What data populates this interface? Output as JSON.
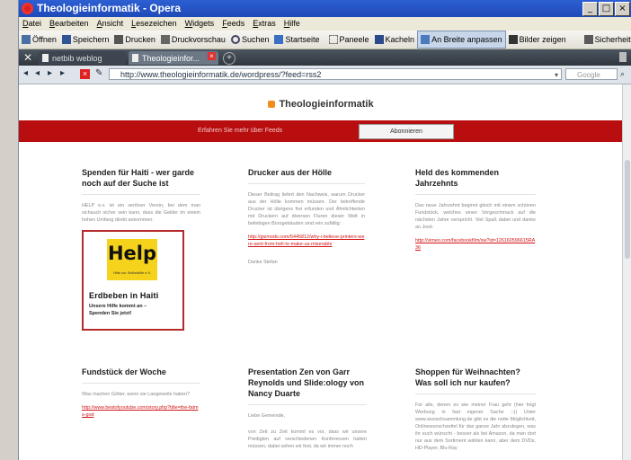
{
  "window": {
    "title": "Theologieinformatik - Opera"
  },
  "menu": [
    "Datei",
    "Bearbeiten",
    "Ansicht",
    "Lesezeichen",
    "Widgets",
    "Feeds",
    "Extras",
    "Hilfe"
  ],
  "toolbar": [
    {
      "label": "Öffnen",
      "icon": "folder-icon"
    },
    {
      "label": "Speichern",
      "icon": "save-icon"
    },
    {
      "label": "Drucken",
      "icon": "print-icon"
    },
    {
      "label": "Druckvorschau",
      "icon": "print-preview-icon"
    },
    {
      "label": "Suchen",
      "icon": "search-icon"
    },
    {
      "label": "Startseite",
      "icon": "home-icon"
    },
    {
      "label": "Paneele",
      "icon": "panels-icon"
    },
    {
      "label": "Kacheln",
      "icon": "tile-icon"
    },
    {
      "label": "An Breite anpassen",
      "icon": "fit-width-icon",
      "active": true
    },
    {
      "label": "Bilder zeigen",
      "icon": "images-icon"
    },
    {
      "label": "Sicherheit",
      "icon": "security-icon"
    }
  ],
  "tabs": [
    "netbib weblog",
    "Theologieinfor..."
  ],
  "address": {
    "url": "http://www.theologieinformatik.de/wordpress/?feed=rss2",
    "search_placeholder": "Google"
  },
  "page": {
    "site_title": "Theologieinformatik",
    "feed_prompt": "Erfahren Sie mehr über Feeds",
    "subscribe_label": "Abonnieren"
  },
  "posts": [
    {
      "title": "Spenden für Haiti - wer garde noch auf der Suche ist",
      "paragraphs": [
        "HELP e.v. ist ein seriöser Verein, bei dem man sichauch sicher sein kann, dass die Gelder im einem hohen Umfang direkt ankommen."
      ],
      "help": {
        "word": "Help",
        "sub": "Hilfe zur Selbsthilfe e.V.",
        "headline": "Erdbeben in Haiti",
        "line1": "Unsere Hilfe kommt an –",
        "line2": "Spenden Sie jetzt!"
      }
    },
    {
      "title": "Drucker aus der Hölle",
      "paragraphs": [
        "Dieser Beitrag liefert den Nachweis, warum Drucker aus der Hölle kommen müssen. Der betreffende Drucker ist übrigens frei erfunden und Ähnlichkeiten mit Druckern auf diversen Fluren dieser Welt in beliebigen Bürogebäuden sind rein zufällig:"
      ],
      "link": "http://gizmodo.com/5445812/why-i-believe-printers-were-sent-from-hell-to-make-us-miserable",
      "signature": "Danke Stefan"
    },
    {
      "title": "Held des kommenden Jahrzehnts",
      "paragraphs": [
        "Das neue Jahrzehnt beginnt gleich mit einem schönen Fundstück, welches einen Vorgeschmack auf die nächsten Jahre verspricht. Viel Spaß dabei und danke an José."
      ],
      "link": "http://vimeo.com/facebookfilm/sw?id=126160596615RA36"
    },
    {
      "title": "Fundstück der Woche",
      "paragraphs": [
        "Was machen Götter, wenn sie Langeweile haben?"
      ],
      "link": "http://www.bestofyoutube.com/story.php?title=the-fatms-god"
    },
    {
      "title": "Presentation Zen von Garr Reynolds und Slide:ology von Nancy Duarte",
      "paragraphs": [
        "Liebe Gemeinde,",
        "von Zeit zu Zeit kommt es vor, dass wir unsere Predigten auf verschiedenen Konferenzen halten müssen, dabei sehen wir fest, da wir immer noch"
      ]
    },
    {
      "title": "Shoppen für Weihnachten? Was soll ich nur kaufen?",
      "paragraphs": [
        "Für alle, denen es wie meiner Frau geht (hier folgt Werbung in fast eigener Sache ;-)) Unter www.wunschsammlung.de gibt es die nette Möglichkeit, Onlinewunschzettel für das ganze Jahr abzulegen, was ihr euch wünscht - besser als bei Amazon, da man dort nur aus dem Sortiment wählen kann, aber dem DVDs, HD-Player, Blu-Ray"
      ]
    }
  ]
}
